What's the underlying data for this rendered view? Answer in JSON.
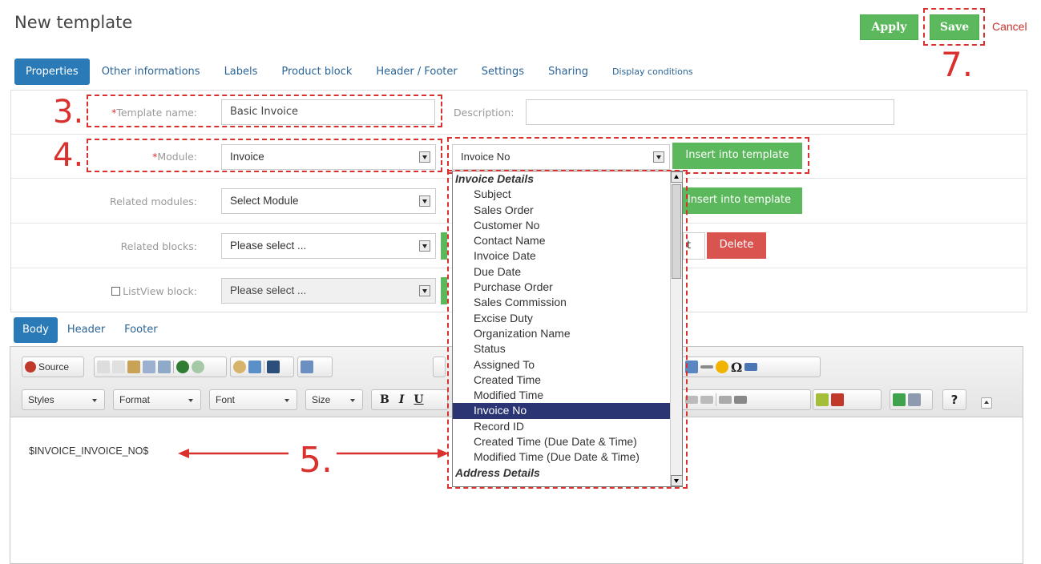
{
  "header": {
    "title": "New template",
    "apply_label": "Apply",
    "save_label": "Save",
    "cancel_label": "Cancel"
  },
  "tabs": [
    {
      "label": "Properties",
      "active": true
    },
    {
      "label": "Other informations"
    },
    {
      "label": "Labels"
    },
    {
      "label": "Product block"
    },
    {
      "label": "Header / Footer"
    },
    {
      "label": "Settings"
    },
    {
      "label": "Sharing"
    },
    {
      "label": "Display conditions"
    }
  ],
  "form": {
    "template_name": {
      "required_mark": "*",
      "label": "Template name:",
      "value": "Basic Invoice"
    },
    "description": {
      "label": "Description:",
      "value": ""
    },
    "module": {
      "required_mark": "*",
      "label": "Module:",
      "value": "Invoice"
    },
    "field_select": {
      "value": "Invoice No"
    },
    "insert_label": "Insert into template",
    "related_modules": {
      "label": "Related modules:",
      "value": "Select Module"
    },
    "related_blocks": {
      "label": "Related blocks:",
      "value": "Please select ..."
    },
    "partial_label": "t",
    "delete_label": "Delete",
    "listview_block": {
      "label": "ListView block:",
      "value": "Please select ..."
    }
  },
  "body_tabs": [
    {
      "label": "Body",
      "active": true
    },
    {
      "label": "Header"
    },
    {
      "label": "Footer"
    }
  ],
  "toolbar": {
    "source_label": "Source",
    "styles_label": "Styles",
    "format_label": "Format",
    "font_label": "Font",
    "size_label": "Size",
    "bold_label": "B",
    "italic_label": "I",
    "underline_label": "U",
    "omega_label": "Ω",
    "help_label": "?"
  },
  "editor": {
    "content": "$INVOICE_INVOICE_NO$"
  },
  "dropdown": {
    "groups": [
      {
        "label": "Invoice Details",
        "items": [
          "Subject",
          "Sales Order",
          "Customer No",
          "Contact Name",
          "Invoice Date",
          "Due Date",
          "Purchase Order",
          "Sales Commission",
          "Excise Duty",
          "Organization Name",
          "Status",
          "Assigned To",
          "Created Time",
          "Modified Time",
          "Invoice No",
          "Record ID",
          "Created Time (Due Date & Time)",
          "Modified Time (Due Date & Time)"
        ]
      },
      {
        "label": "Address Details",
        "items": []
      }
    ],
    "selected": "Invoice No"
  },
  "annotations": {
    "step3": "3.",
    "step4": "4.",
    "step5": "5.",
    "step7": "7."
  },
  "colors": {
    "accent_blue": "#2a7ab8",
    "green": "#5cb85c",
    "red": "#d9534f",
    "annotation_red": "#d9322e",
    "selection": "#2b3573"
  }
}
